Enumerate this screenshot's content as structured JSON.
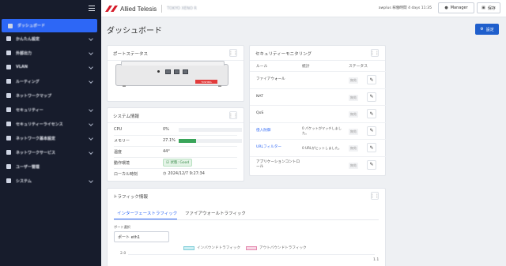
{
  "sidebar": {
    "items": [
      {
        "label": "ダッシュボード",
        "active": true
      },
      {
        "label": "かんたん設定",
        "chevron": true
      },
      {
        "label": "外部出力",
        "chevron": true
      },
      {
        "label": "VLAN",
        "chevron": true
      },
      {
        "label": "ルーティング",
        "chevron": true
      },
      {
        "label": "ネットワークマップ",
        "chevron": false
      },
      {
        "label": "セキュリティー",
        "chevron": true
      },
      {
        "label": "セキュリティーライセンス",
        "chevron": true
      },
      {
        "label": "ネットワーク基本設定",
        "chevron": true
      },
      {
        "label": "ネットワークサービス",
        "chevron": true
      },
      {
        "label": "ユーザー管理",
        "chevron": false
      },
      {
        "label": "システム",
        "chevron": true
      }
    ]
  },
  "header": {
    "logo_text": "Allied Telesis",
    "model": "TOKYO XENO R",
    "user_info": "awplus 稼働時間 4 days 11:35",
    "manager_label": "Manager",
    "save_label": "保存"
  },
  "page": {
    "title": "ダッシュボード",
    "settings_label": "設定"
  },
  "port_status": {
    "title": "ポートステータス",
    "device_tag": "TOSHIBA"
  },
  "system_info": {
    "title": "システム情報",
    "rows": [
      {
        "label": "CPU",
        "value": "0%",
        "bar": 0.0
      },
      {
        "label": "メモリー",
        "value": "27.1%",
        "bar": 0.271
      },
      {
        "label": "温度",
        "value": "44°"
      },
      {
        "label": "動作環境",
        "value": "☑ 状態: Good"
      },
      {
        "label": "ローカル時刻",
        "value": "2024/12/7 9:27:34"
      }
    ],
    "colors": {
      "bar_fill": "#3aa55a"
    }
  },
  "security": {
    "title": "セキュリティーモニタリング",
    "columns": [
      "ルール",
      "統計",
      "ステータス"
    ],
    "rows": [
      {
        "rule": "ファイアウォール",
        "detail": "",
        "status": "無効",
        "link": false
      },
      {
        "rule": "NAT",
        "detail": "",
        "status": "無効",
        "link": false
      },
      {
        "rule": "QoS",
        "detail": "",
        "status": "無効",
        "link": false
      },
      {
        "rule": "侵入防御",
        "detail": "0 パケットがマッチしました。",
        "status": "無効",
        "link": true
      },
      {
        "rule": "URLフィルター",
        "detail": "0 URLがヒットしました。",
        "status": "無効",
        "link": true
      },
      {
        "rule": "アプリケーションコントロール",
        "detail": "",
        "status": "無効",
        "link": false
      }
    ]
  },
  "traffic": {
    "title": "トラフィック情報",
    "tabs": [
      "インターフェーストラフィック",
      "ファイアウォールトラフィック"
    ],
    "port_select_label": "ポート選択",
    "port_select_value": "ポート eth1",
    "legend": [
      {
        "label": "インバウンドトラフィック",
        "color": "#cdeff3",
        "border": "#7fcdd8"
      },
      {
        "label": "アウトバウンドトラフィック",
        "color": "#f7d6e4",
        "border": "#e48ab0"
      }
    ],
    "y_top": "2.0",
    "y_top_right": "1.1"
  }
}
